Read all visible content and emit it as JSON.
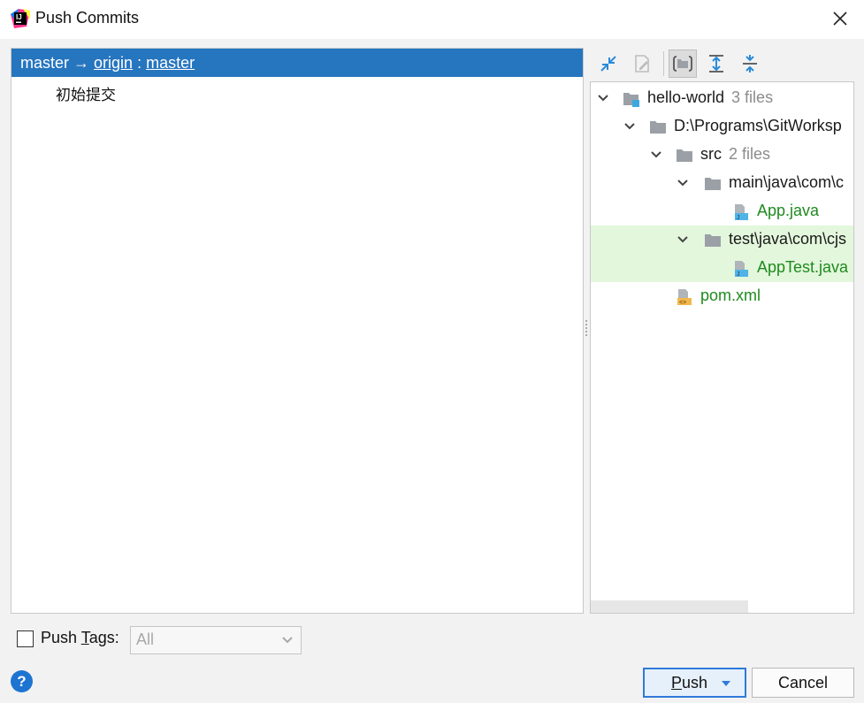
{
  "window": {
    "title": "Push Commits"
  },
  "commits": {
    "branch": {
      "local": "master",
      "arrow": "→",
      "remote": "origin",
      "sep": ":",
      "remote_branch": "master"
    },
    "items": [
      {
        "message": "初始提交"
      }
    ]
  },
  "toolbar": {
    "icons": [
      "collapse-arrows-icon",
      "edit-source-icon",
      "group-by-directory-icon",
      "expand-all-icon",
      "collapse-all-icon"
    ]
  },
  "tree": {
    "rows": [
      {
        "label": "hello-world",
        "count": "3 files"
      },
      {
        "label": "D:\\Programs\\GitWorksp",
        "count": ""
      },
      {
        "label": "src",
        "count": "2 files"
      },
      {
        "label": "main\\java\\com\\c",
        "count": ""
      },
      {
        "label": "App.java",
        "count": ""
      },
      {
        "label": "test\\java\\com\\cjs",
        "count": ""
      },
      {
        "label": "AppTest.java",
        "count": ""
      },
      {
        "label": "pom.xml",
        "count": ""
      }
    ],
    "colors": {
      "modified_file": "#1f8a1f",
      "highlight": "#e3f7dc"
    }
  },
  "bottom": {
    "push_tags_label_pre": "Push ",
    "push_tags_label_u": "T",
    "push_tags_label_post": "ags:",
    "push_tags_checked": false,
    "tags_select_value": "All",
    "help": "?",
    "push_pre": "",
    "push_u": "P",
    "push_post": "ush",
    "cancel": "Cancel"
  },
  "colors": {
    "accent": "#2675bf",
    "push_border": "#2f7ad8"
  }
}
